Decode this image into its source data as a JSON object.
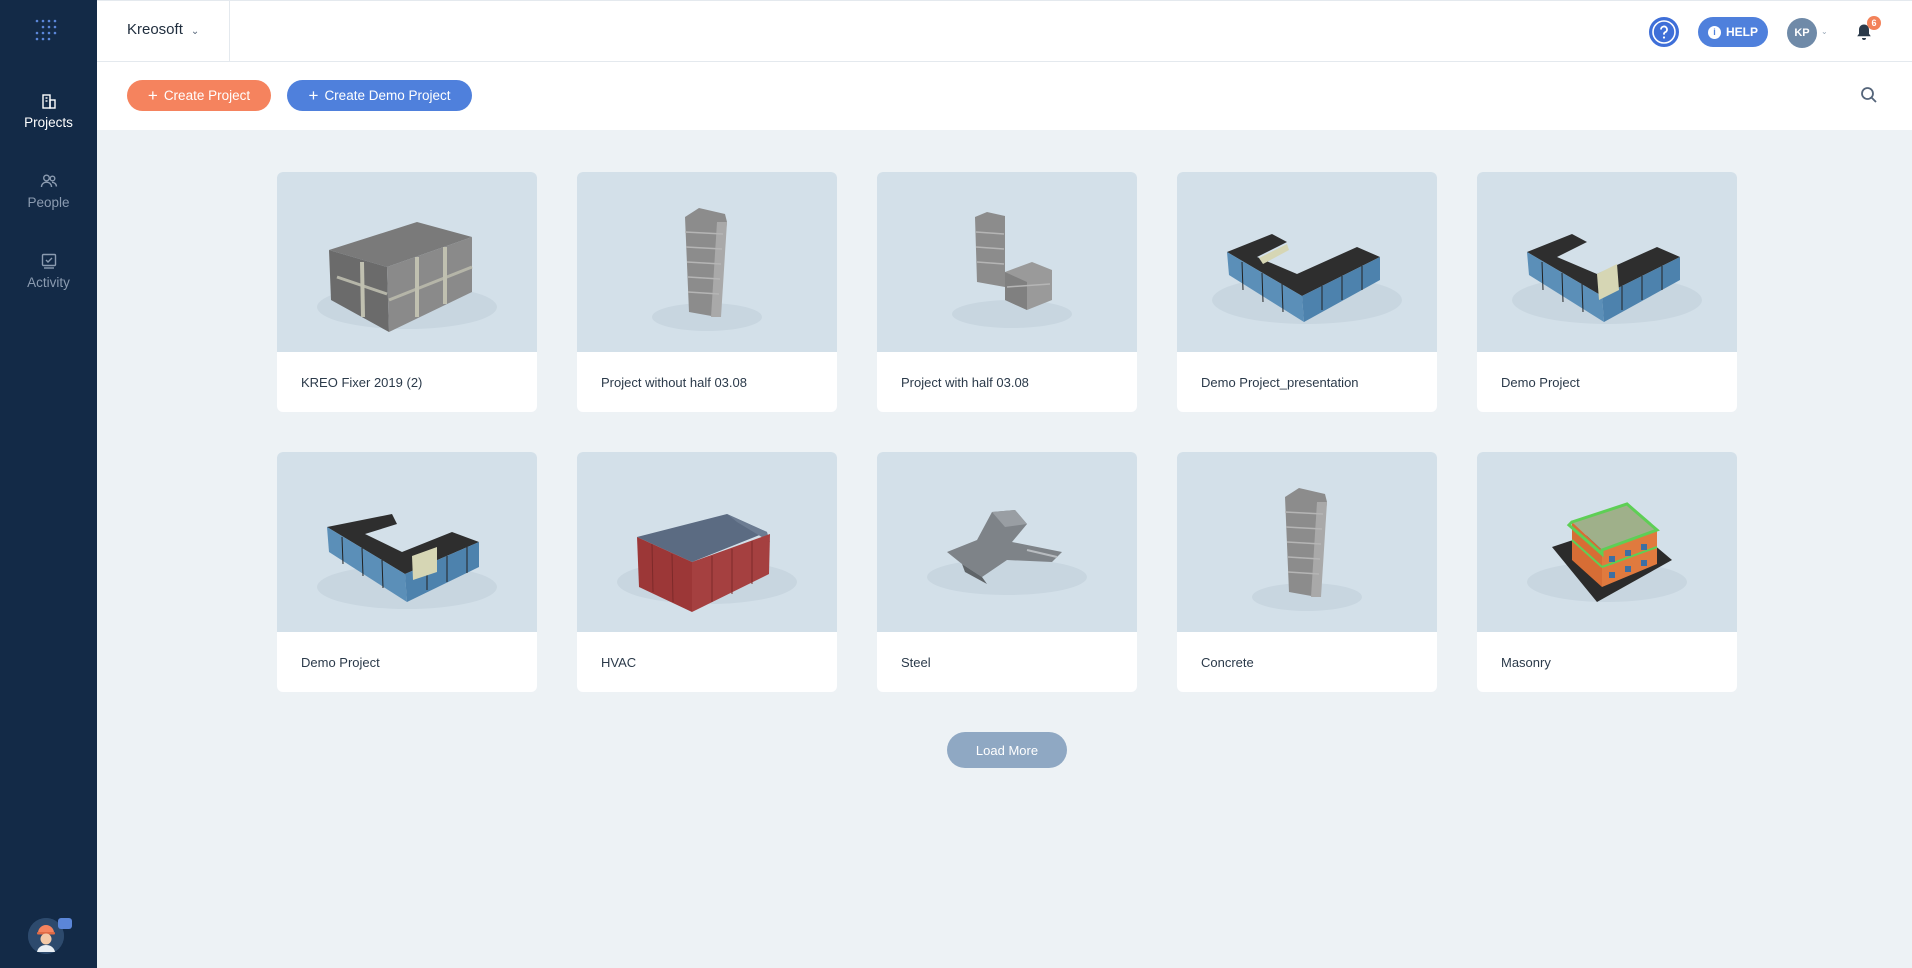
{
  "sidebar": {
    "items": [
      {
        "label": "Projects",
        "icon": "building-icon",
        "active": true
      },
      {
        "label": "People",
        "icon": "people-icon",
        "active": false
      },
      {
        "label": "Activity",
        "icon": "activity-icon",
        "active": false
      }
    ]
  },
  "header": {
    "company": "Kreosoft",
    "help_label": "HELP",
    "user_initials": "KP",
    "notification_count": "6"
  },
  "toolbar": {
    "create_project_label": "Create Project",
    "create_demo_label": "Create Demo Project"
  },
  "projects": [
    {
      "title": "KREO Fixer 2019 (2)",
      "thumb": "box-building"
    },
    {
      "title": "Project without half 03.08",
      "thumb": "tower"
    },
    {
      "title": "Project with half 03.08",
      "thumb": "tower-annex"
    },
    {
      "title": "Demo Project_presentation",
      "thumb": "l-shape"
    },
    {
      "title": "Demo Project",
      "thumb": "l-shape"
    },
    {
      "title": "Demo Project",
      "thumb": "l-shape"
    },
    {
      "title": "HVAC",
      "thumb": "warehouse"
    },
    {
      "title": "Steel",
      "thumb": "steel"
    },
    {
      "title": "Concrete",
      "thumb": "tower"
    },
    {
      "title": "Masonry",
      "thumb": "masonry"
    }
  ],
  "load_more_label": "Load More",
  "colors": {
    "sidebar_bg": "#132a47",
    "primary_blue": "#4f80dc",
    "accent_orange": "#f5835e",
    "page_bg": "#edf2f5"
  }
}
